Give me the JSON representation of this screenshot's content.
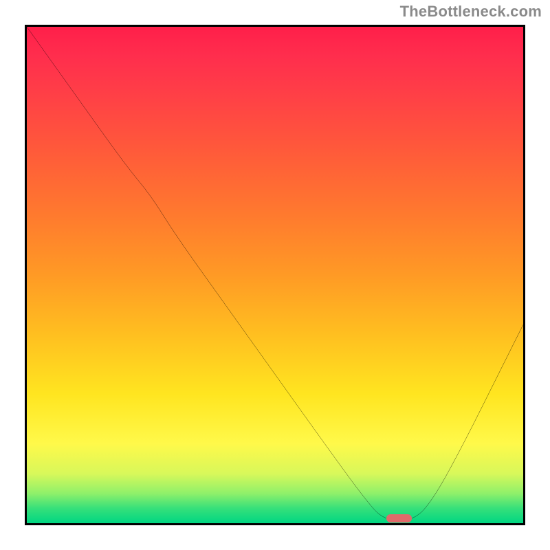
{
  "watermark": "TheBottleneck.com",
  "chart_data": {
    "type": "line",
    "title": "",
    "xlabel": "",
    "ylabel": "",
    "xlim": [
      0,
      100
    ],
    "ylim": [
      0,
      100
    ],
    "grid": false,
    "legend": false,
    "annotations": [],
    "comment": "Values are approximate, read from the plotted curve as percent of axis range. y=100 is top, y=0 is bottom. Curve starts at top-left, dips to a minimum near x≈75 at the bottom, then rises toward the right edge.",
    "x": [
      0,
      10,
      20,
      25,
      30,
      40,
      50,
      60,
      68,
      72,
      78,
      82,
      88,
      95,
      100
    ],
    "y": [
      100,
      86,
      72,
      66,
      58,
      44,
      30,
      16,
      5,
      0.5,
      0.5,
      5,
      16,
      30,
      40
    ],
    "gradient_stops": [
      {
        "pos": 0,
        "color": "#ff1f4a"
      },
      {
        "pos": 25,
        "color": "#ff5a3a"
      },
      {
        "pos": 50,
        "color": "#ff9a25"
      },
      {
        "pos": 74,
        "color": "#ffe520"
      },
      {
        "pos": 90,
        "color": "#d8f85a"
      },
      {
        "pos": 100,
        "color": "#00d682"
      }
    ],
    "marker": {
      "comment": "Small red pill on the x-axis marking optimum / zero-bottleneck position.",
      "x_center_pct": 75,
      "width_pct": 5,
      "color": "#e06a6a"
    }
  },
  "frame": {
    "border_color": "#000000",
    "border_width_px": 3
  }
}
